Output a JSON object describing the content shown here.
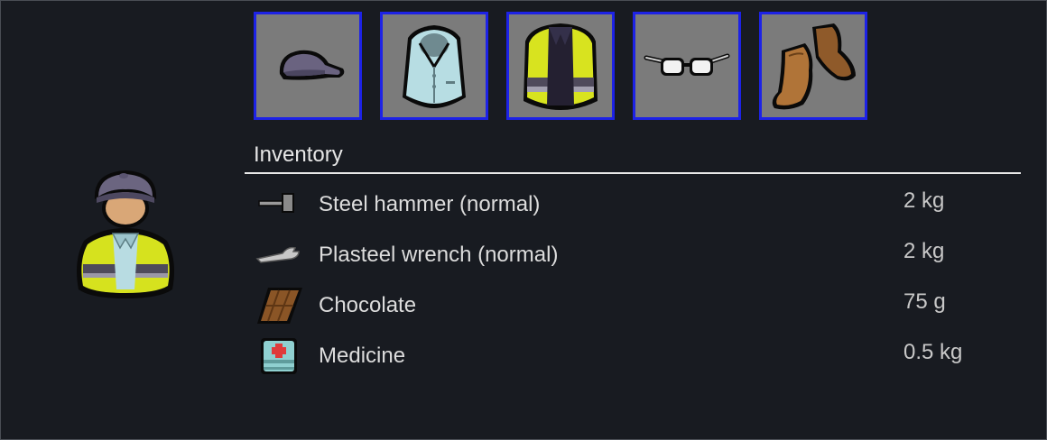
{
  "apparel": [
    {
      "name": "cap"
    },
    {
      "name": "shirt"
    },
    {
      "name": "safety-vest"
    },
    {
      "name": "glasses"
    },
    {
      "name": "boots"
    }
  ],
  "inventory": {
    "title": "Inventory",
    "items": [
      {
        "label": "Steel hammer (normal)",
        "mass": "2 kg",
        "icon": "hammer-icon"
      },
      {
        "label": "Plasteel wrench (normal)",
        "mass": "2 kg",
        "icon": "wrench-icon"
      },
      {
        "label": "Chocolate",
        "mass": "75 g",
        "icon": "chocolate-icon"
      },
      {
        "label": "Medicine",
        "mass": "0.5 kg",
        "icon": "medicine-icon"
      }
    ]
  },
  "colors": {
    "slot_border": "#1d22e6",
    "slot_background": "#7b7b7b",
    "panel_background": "#181b21"
  }
}
